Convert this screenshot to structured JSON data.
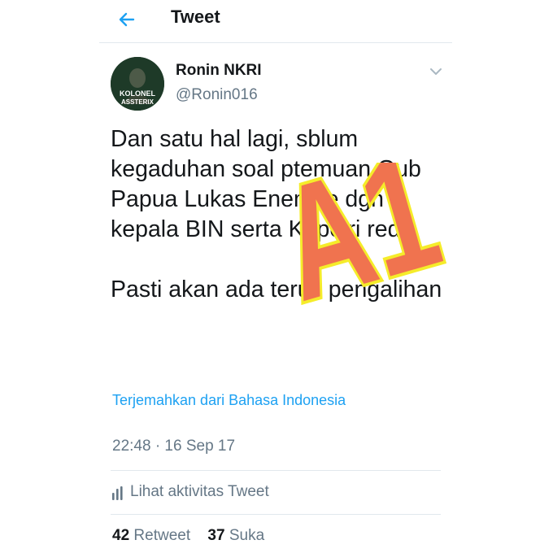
{
  "header": {
    "title": "Tweet",
    "back_icon": "arrow-left-icon"
  },
  "tweet": {
    "display_name": "Ronin NKRI",
    "handle": "@Ronin016",
    "avatar_text": [
      "KOLONEL",
      "ASSTERIX"
    ],
    "text": "Dan satu hal lagi, sblum kegaduhan soal ptemuan Gub Papua Lukas Enembe dgn kepala BIN serta Kapolri reda\n\nPasti akan ada terus pengalihan",
    "translate_link": "Terjemahkan dari Bahasa Indonesia",
    "timestamp": "22:48 · 16 Sep 17",
    "activity_label": "Lihat aktivitas Tweet",
    "retweet_count": "42",
    "retweet_label": "Retweet",
    "like_count": "37",
    "like_label": "Suka"
  },
  "watermark": {
    "text": "A1",
    "fill": "#f0734f",
    "stroke": "#f5ec2a"
  },
  "colors": {
    "accent": "#1da1f2",
    "text": "#14171a",
    "secondary": "#657786",
    "divider": "#e1e8ed"
  }
}
